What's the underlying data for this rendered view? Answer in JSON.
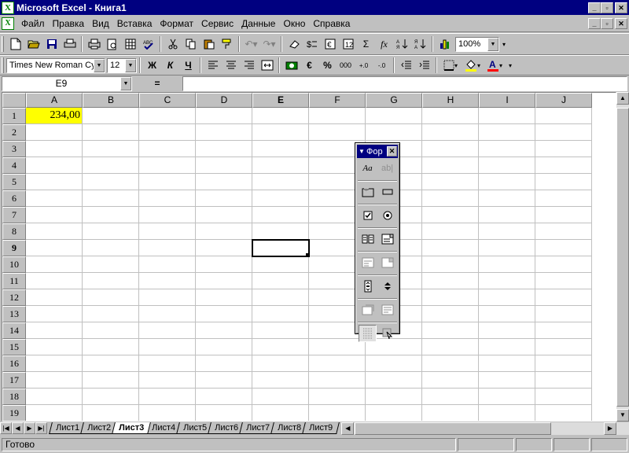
{
  "window": {
    "title": "Microsoft Excel - Книга1",
    "minimize": "_",
    "maximize": "▫",
    "close": "✕"
  },
  "menu": [
    "Файл",
    "Правка",
    "Вид",
    "Вставка",
    "Формат",
    "Сервис",
    "Данные",
    "Окно",
    "Справка"
  ],
  "toolbar_standard": {
    "zoom": "100%",
    "autosum": "Σ",
    "function": "fx"
  },
  "toolbar_formatting": {
    "font": "Times New Roman Cyr",
    "size": "12",
    "bold": "Ж",
    "italic": "К",
    "underline": "Ч",
    "currency": "€",
    "percent": "%",
    "thousands": "000",
    "inc_decimal": "+.0",
    "dec_decimal": "-.0"
  },
  "formula_bar": {
    "name_box": "E9",
    "equals": "=",
    "formula": ""
  },
  "grid": {
    "columns": [
      "A",
      "B",
      "C",
      "D",
      "E",
      "F",
      "G",
      "H",
      "I",
      "J"
    ],
    "rows": [
      "1",
      "2",
      "3",
      "4",
      "5",
      "6",
      "7",
      "8",
      "9",
      "10",
      "11",
      "12",
      "13",
      "14",
      "15",
      "16",
      "17",
      "18",
      "19"
    ],
    "active_column": "E",
    "active_row": "9",
    "cells": {
      "A1": "234,00"
    },
    "cell_a1_fill": "#ffff00"
  },
  "forms_toolbar": {
    "title": "Фор",
    "label_btn": "Aa",
    "edit_btn": "ab|"
  },
  "sheet_tabs": [
    "Лист1",
    "Лист2",
    "Лист3",
    "Лист4",
    "Лист5",
    "Лист6",
    "Лист7",
    "Лист8",
    "Лист9"
  ],
  "active_tab": "Лист3",
  "status": {
    "text": "Готово"
  },
  "colors": {
    "titlebar": "#000080",
    "chrome": "#c0c0c0",
    "highlight_cell": "#ffff00"
  }
}
